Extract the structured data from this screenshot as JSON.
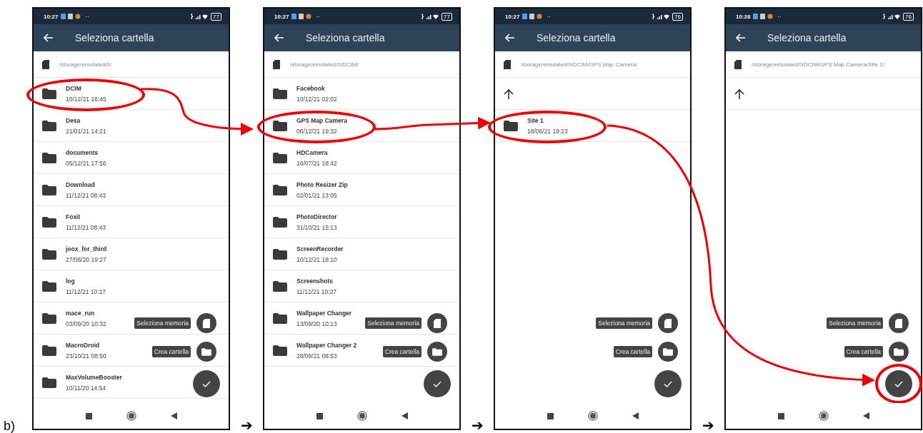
{
  "label": "b)",
  "step_arrows": [
    "➔",
    "➔",
    "➔"
  ],
  "screens": [
    {
      "time": "10:27",
      "dots": "··",
      "battery": "77",
      "title": "Seleziona cartella",
      "path": "/storage/emulated/0/",
      "up_row": false,
      "memory_label": "Seleziona memoria",
      "create_label": "Crea cartella",
      "confirm_highlighted": false,
      "folders": [
        {
          "name": "DCIM",
          "date": "10/12/21 16:45",
          "highlighted": true
        },
        {
          "name": "Desa",
          "date": "21/01/21 14:21",
          "highlighted": false
        },
        {
          "name": "documents",
          "date": "05/12/21 17:56",
          "highlighted": false
        },
        {
          "name": "Download",
          "date": "11/12/21 08:43",
          "highlighted": false
        },
        {
          "name": "Foxit",
          "date": "11/12/21 08:43",
          "highlighted": false
        },
        {
          "name": "joox_for_third",
          "date": "27/08/20 19:27",
          "highlighted": false
        },
        {
          "name": "log",
          "date": "11/12/21 10:17",
          "highlighted": false
        },
        {
          "name": "mace_run",
          "date": "03/09/20 10:32",
          "highlighted": false
        },
        {
          "name": "MacroDroid",
          "date": "23/10/21 08:50",
          "highlighted": false
        },
        {
          "name": "MaxVolumeBooster",
          "date": "10/11/20 14:54",
          "highlighted": false
        }
      ]
    },
    {
      "time": "10:27",
      "dots": "··",
      "battery": "77",
      "title": "Seleziona cartella",
      "path": "/storage/emulated/0/DCIM/",
      "up_row": false,
      "memory_label": "Seleziona memoria",
      "create_label": "Crea cartella",
      "confirm_highlighted": false,
      "folders": [
        {
          "name": "Facebook",
          "date": "10/12/21 02:02",
          "highlighted": false
        },
        {
          "name": "GPS Map Camera",
          "date": "06/12/21 19:32",
          "highlighted": true
        },
        {
          "name": "HDCamera",
          "date": "16/07/21 18:42",
          "highlighted": false
        },
        {
          "name": "Photo Resizer Zip",
          "date": "02/01/21 13:05",
          "highlighted": false
        },
        {
          "name": "PhotoDirector",
          "date": "31/10/21 15:13",
          "highlighted": false
        },
        {
          "name": "ScreenRecorder",
          "date": "10/12/21 18:10",
          "highlighted": false
        },
        {
          "name": "Screenshots",
          "date": "11/12/21 10:27",
          "highlighted": false
        },
        {
          "name": "Wallpaper Changer",
          "date": "13/09/20 10:13",
          "highlighted": false
        },
        {
          "name": "Wallpaper Changer 2",
          "date": "28/09/21 08:53",
          "highlighted": false
        }
      ]
    },
    {
      "time": "10:27",
      "dots": "··",
      "battery": "76",
      "title": "Seleziona cartella",
      "path": "/storage/emulated/0/DCIM/GPS Map Camera/",
      "up_row": true,
      "memory_label": "Seleziona memoria",
      "create_label": "Crea cartella",
      "confirm_highlighted": false,
      "folders": [
        {
          "name": "Site 1",
          "date": "18/06/21 19:23",
          "highlighted": true
        }
      ]
    },
    {
      "time": "10:28",
      "dots": "··",
      "battery": "76",
      "title": "Seleziona cartella",
      "path": "/storage/emulated/0/DCIM/GPS Map Camera/Site 1/",
      "up_row": true,
      "memory_label": "Seleziona memoria",
      "create_label": "Crea cartella",
      "confirm_highlighted": true
    }
  ]
}
